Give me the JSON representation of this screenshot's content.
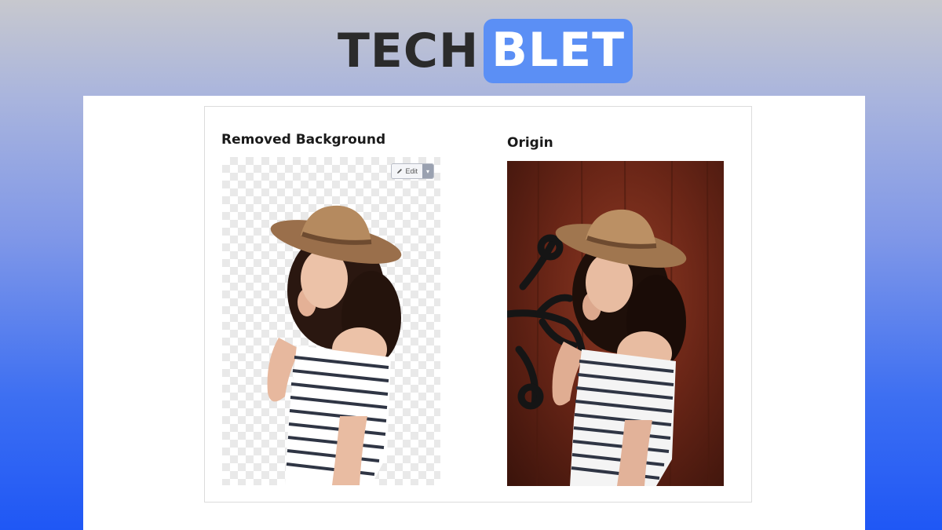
{
  "logo": {
    "part1": "TECH",
    "part2": "BLET"
  },
  "cards": {
    "removed": {
      "title": "Removed Background",
      "edit_label": "Edit"
    },
    "origin": {
      "title": "Origin"
    }
  },
  "icons": {
    "edit": "pencil-icon",
    "dropdown": "caret-down-icon"
  },
  "colors": {
    "brand_blue": "#5b8ff5",
    "dark_text": "#2b2b2b"
  }
}
